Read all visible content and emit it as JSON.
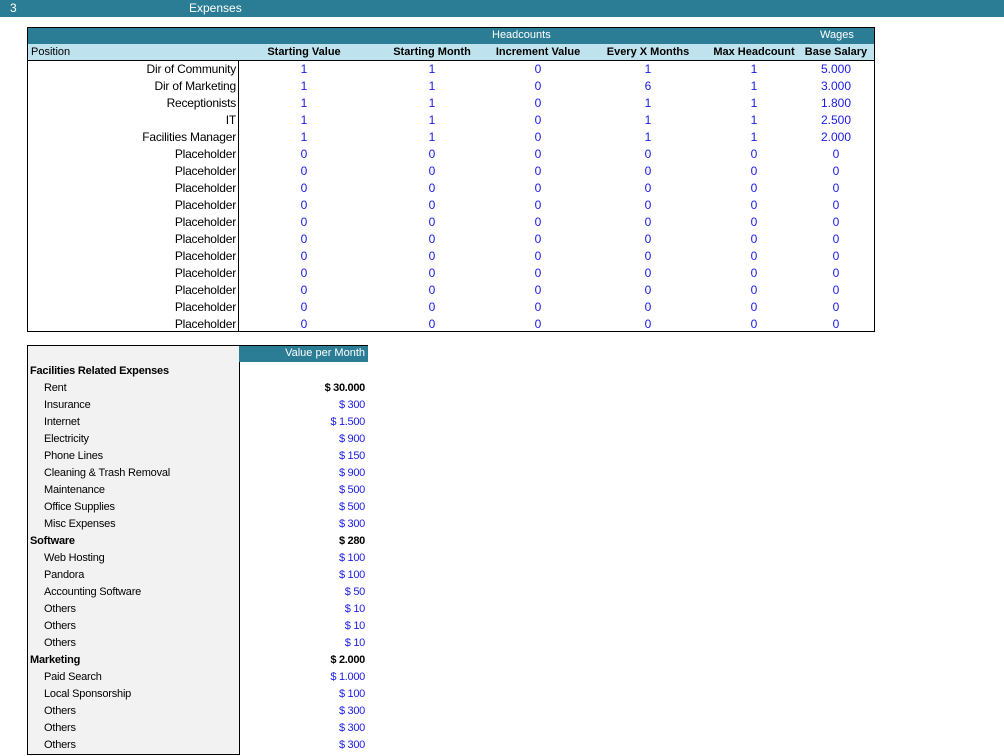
{
  "topbar": {
    "number": "3",
    "title": "Expenses"
  },
  "headcount_table": {
    "group_headers": {
      "headcounts": "Headcounts",
      "wages": "Wages"
    },
    "columns": [
      "Position",
      "Starting Value",
      "Starting Month",
      "Increment Value",
      "Every X Months",
      "Max Headcount",
      "Base Salary"
    ],
    "rows": [
      {
        "position": "Dir of Community",
        "starting_value": "1",
        "starting_month": "1",
        "increment_value": "0",
        "every_x_months": "1",
        "max_headcount": "1",
        "base_salary": "5.000"
      },
      {
        "position": "Dir of Marketing",
        "starting_value": "1",
        "starting_month": "1",
        "increment_value": "0",
        "every_x_months": "6",
        "max_headcount": "1",
        "base_salary": "3.000"
      },
      {
        "position": "Receptionists",
        "starting_value": "1",
        "starting_month": "1",
        "increment_value": "0",
        "every_x_months": "1",
        "max_headcount": "1",
        "base_salary": "1.800"
      },
      {
        "position": "IT",
        "starting_value": "1",
        "starting_month": "1",
        "increment_value": "0",
        "every_x_months": "1",
        "max_headcount": "1",
        "base_salary": "2.500"
      },
      {
        "position": "Facilities Manager",
        "starting_value": "1",
        "starting_month": "1",
        "increment_value": "0",
        "every_x_months": "1",
        "max_headcount": "1",
        "base_salary": "2.000"
      },
      {
        "position": "Placeholder",
        "starting_value": "0",
        "starting_month": "0",
        "increment_value": "0",
        "every_x_months": "0",
        "max_headcount": "0",
        "base_salary": "0"
      },
      {
        "position": "Placeholder",
        "starting_value": "0",
        "starting_month": "0",
        "increment_value": "0",
        "every_x_months": "0",
        "max_headcount": "0",
        "base_salary": "0"
      },
      {
        "position": "Placeholder",
        "starting_value": "0",
        "starting_month": "0",
        "increment_value": "0",
        "every_x_months": "0",
        "max_headcount": "0",
        "base_salary": "0"
      },
      {
        "position": "Placeholder",
        "starting_value": "0",
        "starting_month": "0",
        "increment_value": "0",
        "every_x_months": "0",
        "max_headcount": "0",
        "base_salary": "0"
      },
      {
        "position": "Placeholder",
        "starting_value": "0",
        "starting_month": "0",
        "increment_value": "0",
        "every_x_months": "0",
        "max_headcount": "0",
        "base_salary": "0"
      },
      {
        "position": "Placeholder",
        "starting_value": "0",
        "starting_month": "0",
        "increment_value": "0",
        "every_x_months": "0",
        "max_headcount": "0",
        "base_salary": "0"
      },
      {
        "position": "Placeholder",
        "starting_value": "0",
        "starting_month": "0",
        "increment_value": "0",
        "every_x_months": "0",
        "max_headcount": "0",
        "base_salary": "0"
      },
      {
        "position": "Placeholder",
        "starting_value": "0",
        "starting_month": "0",
        "increment_value": "0",
        "every_x_months": "0",
        "max_headcount": "0",
        "base_salary": "0"
      },
      {
        "position": "Placeholder",
        "starting_value": "0",
        "starting_month": "0",
        "increment_value": "0",
        "every_x_months": "0",
        "max_headcount": "0",
        "base_salary": "0"
      },
      {
        "position": "Placeholder",
        "starting_value": "0",
        "starting_month": "0",
        "increment_value": "0",
        "every_x_months": "0",
        "max_headcount": "0",
        "base_salary": "0"
      },
      {
        "position": "Placeholder",
        "starting_value": "0",
        "starting_month": "0",
        "increment_value": "0",
        "every_x_months": "0",
        "max_headcount": "0",
        "base_salary": "0"
      }
    ]
  },
  "expense_table": {
    "header": "Value per Month",
    "rows": [
      {
        "label": "Facilities Related Expenses",
        "value": "",
        "category": true
      },
      {
        "label": "Rent",
        "value": "$ 30.000",
        "bold": true
      },
      {
        "label": "Insurance",
        "value": "$ 300"
      },
      {
        "label": "Internet",
        "value": "$ 1.500"
      },
      {
        "label": "Electricity",
        "value": "$ 900"
      },
      {
        "label": "Phone Lines",
        "value": "$ 150"
      },
      {
        "label": "Cleaning & Trash Removal",
        "value": "$ 900"
      },
      {
        "label": "Maintenance",
        "value": "$ 500"
      },
      {
        "label": "Office Supplies",
        "value": "$ 500"
      },
      {
        "label": "Misc Expenses",
        "value": "$ 300"
      },
      {
        "label": "Software",
        "value": "$ 280",
        "category": true
      },
      {
        "label": "Web Hosting",
        "value": "$ 100"
      },
      {
        "label": "Pandora",
        "value": "$ 100"
      },
      {
        "label": "Accounting Software",
        "value": "$ 50"
      },
      {
        "label": "Others",
        "value": "$ 10"
      },
      {
        "label": "Others",
        "value": "$ 10"
      },
      {
        "label": "Others",
        "value": "$ 10"
      },
      {
        "label": "Marketing",
        "value": "$ 2.000",
        "category": true
      },
      {
        "label": "Paid Search",
        "value": "$ 1.000"
      },
      {
        "label": "Local Sponsorship",
        "value": "$ 100"
      },
      {
        "label": "Others",
        "value": "$ 300"
      },
      {
        "label": "Others",
        "value": "$ 300"
      },
      {
        "label": "Others",
        "value": "$ 300"
      }
    ]
  },
  "colors": {
    "header_band": "#2b7d96",
    "header_row": "#bfe3ee",
    "input_value": "#1a1ae6"
  }
}
